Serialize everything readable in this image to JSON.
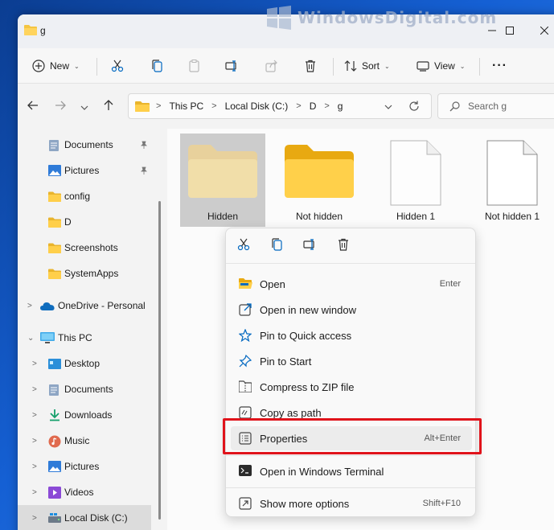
{
  "window": {
    "title": "g"
  },
  "watermark": {
    "text": "WindowsDigital.com"
  },
  "toolbar": {
    "new_label": "New",
    "sort_label": "Sort",
    "view_label": "View",
    "more_label": "···"
  },
  "address": {
    "crumbs": [
      "This PC",
      "Local Disk (C:)",
      "D",
      "g"
    ],
    "search_placeholder": "Search g"
  },
  "sidebar": {
    "items": [
      {
        "label": "Documents"
      },
      {
        "label": "Pictures"
      },
      {
        "label": "config"
      },
      {
        "label": "D"
      },
      {
        "label": "Screenshots"
      },
      {
        "label": "SystemApps"
      },
      {
        "label": "OneDrive - Personal"
      },
      {
        "label": "This PC"
      },
      {
        "label": "Desktop"
      },
      {
        "label": "Documents"
      },
      {
        "label": "Downloads"
      },
      {
        "label": "Music"
      },
      {
        "label": "Pictures"
      },
      {
        "label": "Videos"
      },
      {
        "label": "Local Disk (C:)"
      }
    ]
  },
  "files": [
    {
      "name": "Hidden"
    },
    {
      "name": "Not hidden"
    },
    {
      "name": "Hidden 1"
    },
    {
      "name": "Not hidden 1"
    }
  ],
  "context_menu": {
    "items": [
      {
        "label": "Open",
        "shortcut": "Enter"
      },
      {
        "label": "Open in new window",
        "shortcut": ""
      },
      {
        "label": "Pin to Quick access",
        "shortcut": ""
      },
      {
        "label": "Pin to Start",
        "shortcut": ""
      },
      {
        "label": "Compress to ZIP file",
        "shortcut": ""
      },
      {
        "label": "Copy as path",
        "shortcut": ""
      },
      {
        "label": "Properties",
        "shortcut": "Alt+Enter"
      },
      {
        "label": "Open in Windows Terminal",
        "shortcut": ""
      },
      {
        "label": "Show more options",
        "shortcut": "Shift+F10"
      }
    ]
  },
  "colors": {
    "accent": "#0067c0",
    "folder": "#f4c542",
    "highlight": "#e0131b"
  }
}
